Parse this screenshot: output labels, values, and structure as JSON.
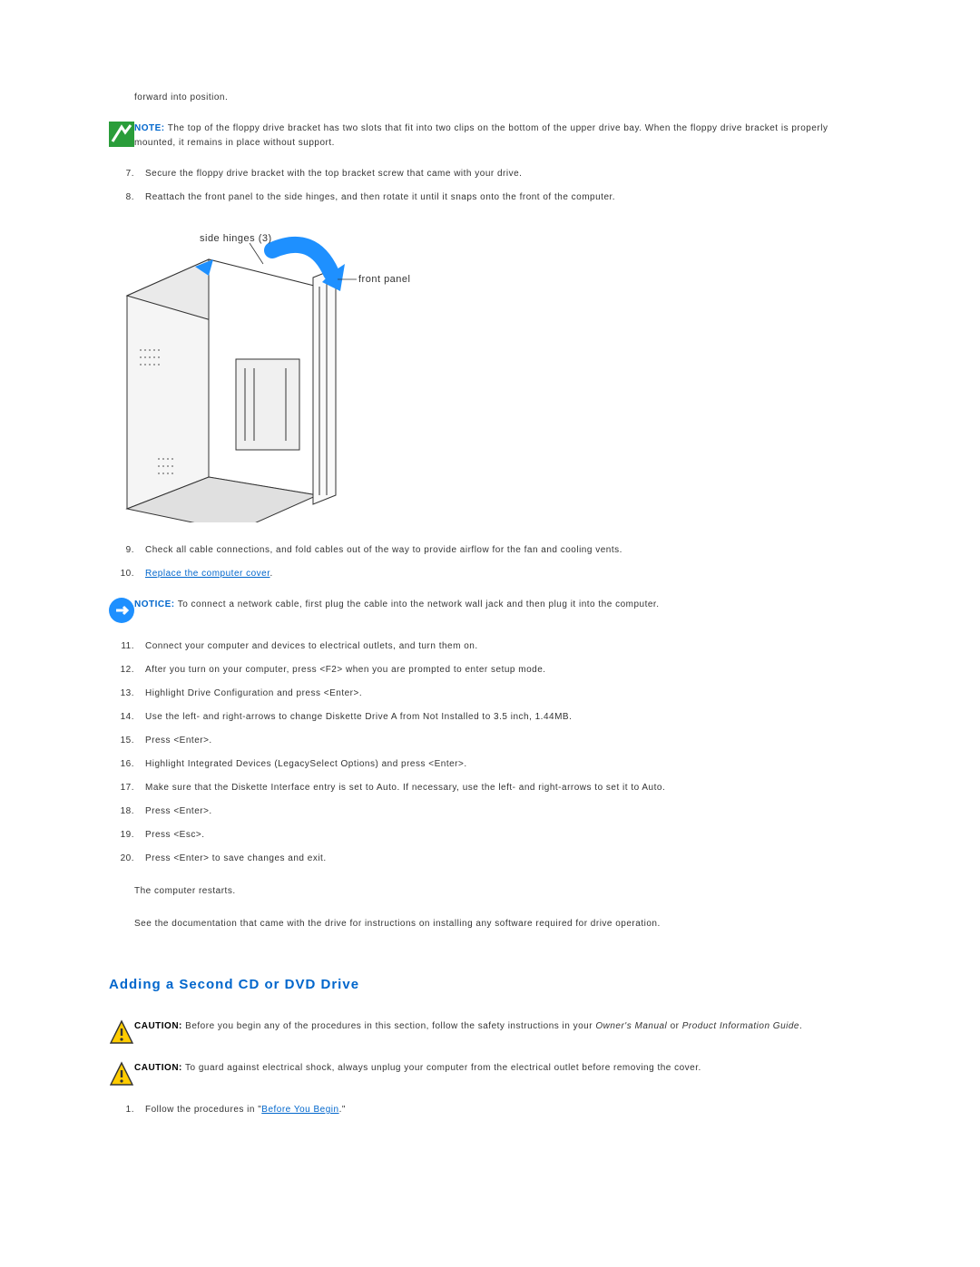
{
  "top": {
    "fragment": "forward into position."
  },
  "note1": {
    "label": "NOTE:",
    "text": " The top of the floppy drive bracket has two slots that fit into two clips on the bottom of the upper drive bay. When the floppy drive bracket is properly mounted, it remains in place without support."
  },
  "steps_a": [
    {
      "n": "7.",
      "t": "Secure the floppy drive bracket with the top bracket screw that came with your drive."
    },
    {
      "n": "8.",
      "t": "Reattach the front panel to the side hinges, and then rotate it until it snaps onto the front of the computer."
    }
  ],
  "figure": {
    "label_hinges": "side hinges (3)",
    "label_front": "front panel"
  },
  "steps_b": [
    {
      "n": "9.",
      "t": "Check all cable connections, and fold cables out of the way to provide airflow for the fan and cooling vents."
    }
  ],
  "step10": {
    "n": "10.",
    "link": "Replace the computer cover",
    "suffix": "."
  },
  "notice1": {
    "label": "NOTICE:",
    "text": " To connect a network cable, first plug the cable into the network wall jack and then plug it into the computer."
  },
  "steps_c": [
    {
      "n": "11.",
      "t": "Connect your computer and devices to electrical outlets, and turn them on."
    },
    {
      "n": "12.",
      "t": "After you turn on your computer, press <F2> when you are prompted to enter setup mode."
    },
    {
      "n": "13.",
      "t": "Highlight Drive Configuration and press <Enter>."
    },
    {
      "n": "14.",
      "t": "Use the left- and right-arrows to change Diskette Drive A from Not Installed to 3.5 inch, 1.44MB."
    },
    {
      "n": "15.",
      "t": "Press <Enter>."
    },
    {
      "n": "16.",
      "t": "Highlight Integrated Devices (LegacySelect Options) and press <Enter>."
    },
    {
      "n": "17.",
      "t": "Make sure that the Diskette Interface entry is set to Auto. If necessary, use the left- and right-arrows to set it to Auto."
    },
    {
      "n": "18.",
      "t": "Press <Enter>."
    },
    {
      "n": "19.",
      "t": "Press <Esc>."
    },
    {
      "n": "20.",
      "t": "Press <Enter> to save changes and exit."
    }
  ],
  "para1": "The computer restarts.",
  "para2": "See the documentation that came with the drive for instructions on installing any software required for drive operation.",
  "heading": "Adding a Second CD or DVD Drive",
  "caution1": {
    "label": "CAUTION:",
    "pre": " Before you begin any of the procedures in this section, follow the safety instructions in your ",
    "ital1": "Owner's Manual",
    "mid": " or ",
    "ital2": "Product Information Guide",
    "suffix": "."
  },
  "caution2": {
    "label": "CAUTION:",
    "text": " To guard against electrical shock, always unplug your computer from the electrical outlet before removing the cover."
  },
  "step_d1": {
    "n": "1.",
    "pre": "Follow the procedures in \"",
    "link": "Before You Begin",
    "suffix": ".\""
  }
}
